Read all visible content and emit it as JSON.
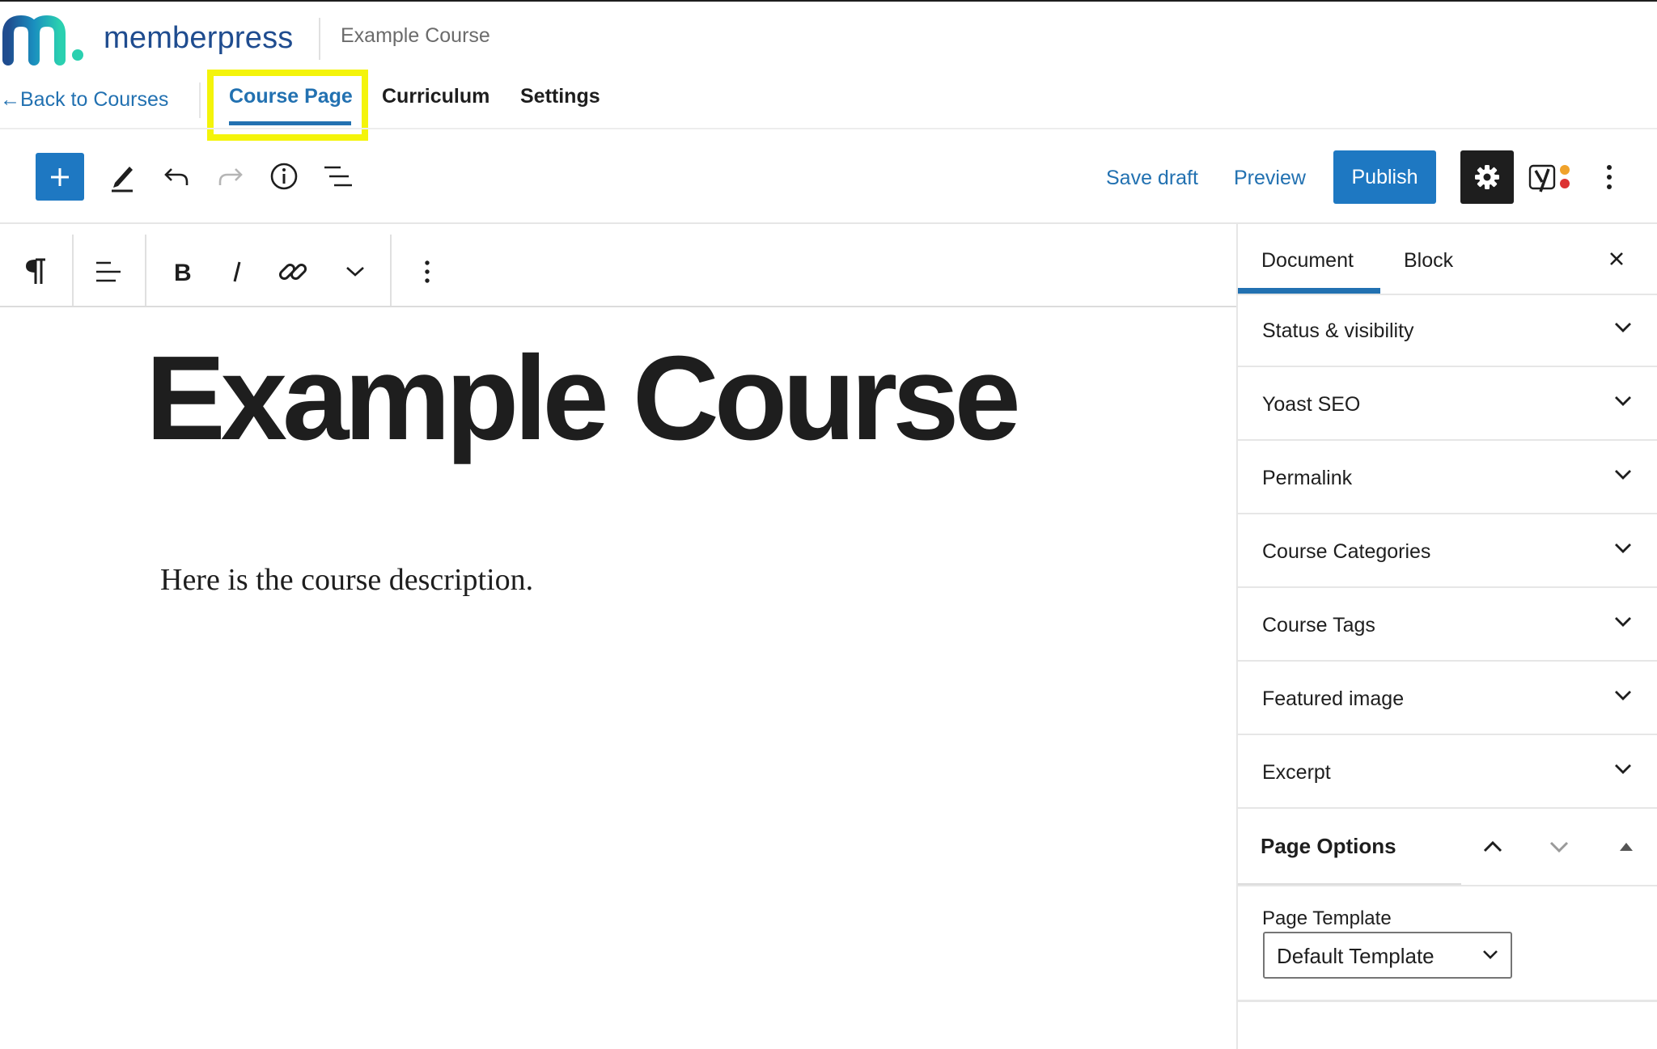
{
  "app": {
    "brand": "memberpress",
    "course_name": "Example Course"
  },
  "nav": {
    "back_label": "←Back to Courses",
    "tabs": [
      {
        "label": "Course Page",
        "active": true
      },
      {
        "label": "Curriculum"
      },
      {
        "label": "Settings"
      }
    ]
  },
  "toolbar": {
    "add_icon": "plus-icon",
    "tools_icon": "pencil-icon",
    "undo_icon": "undo-icon",
    "redo_icon": "redo-icon",
    "info_icon": "info-icon",
    "outline_icon": "list-view-icon",
    "save_draft": "Save draft",
    "preview": "Preview",
    "publish": "Publish",
    "settings_icon": "gear-icon",
    "plugin_icon": "yoast-icon",
    "more_icon": "more-vertical-icon"
  },
  "block_toolbar": {
    "icons": [
      "paragraph-icon",
      "align-left-icon",
      "bold-icon",
      "italic-icon",
      "link-icon",
      "chevron-down-icon",
      "more-vertical-icon"
    ]
  },
  "post": {
    "title": "Example Course",
    "body": "Here is the course description."
  },
  "sidebar": {
    "tabs": [
      {
        "label": "Document",
        "active": true
      },
      {
        "label": "Block"
      }
    ],
    "panels": [
      {
        "label": "Status & visibility"
      },
      {
        "label": "Yoast SEO"
      },
      {
        "label": "Permalink"
      },
      {
        "label": "Course Categories"
      },
      {
        "label": "Course Tags"
      },
      {
        "label": "Featured image"
      },
      {
        "label": "Excerpt"
      }
    ],
    "page_options": {
      "title": "Page Options",
      "template_label": "Page Template",
      "template_value": "Default Template"
    }
  },
  "colors": {
    "accent": "#2271b1",
    "highlight": "#f4f40a",
    "dark": "#1e1e1e"
  }
}
